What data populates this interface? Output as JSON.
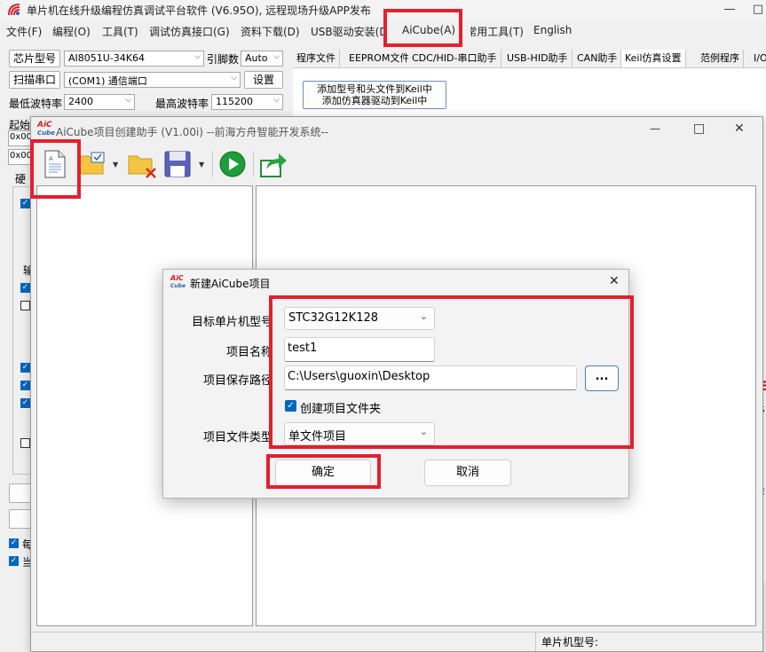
{
  "main_window": {
    "title": "单片机在线升级编程仿真调试平台软件 (V6.95O), 远程现场升级APP发布",
    "controls": {
      "minimize": "—",
      "maximize": "□"
    },
    "menu": [
      "文件(F)",
      "编程(O)",
      "工具(T)",
      "调试仿真接口(G)",
      "资料下载(D)",
      "USB驱动安装(D)",
      "AiCube(A)",
      "常用工具(T)",
      "English"
    ]
  },
  "left_panel": {
    "chip_label": "芯片型号",
    "chip_value": "AI8051U-34K64",
    "pins_label": "引脚数",
    "pins_value": "Auto",
    "scan_button": "扫描串口",
    "port_value": "(COM1) 通信端口",
    "settings_button": "设置",
    "min_baud_label": "最低波特率",
    "min_baud_value": "2400",
    "max_baud_label": "最高波特率",
    "max_baud_value": "115200",
    "start_label": "起始",
    "addr1": "0x00",
    "addr2": "0x00",
    "hw_label": "硬",
    "out_label": "输",
    "bottom_check1": "每",
    "bottom_check2": "当"
  },
  "tabs": [
    "程序文件",
    "EEPROM文件",
    "CDC/HID-串口助手",
    "USB-HID助手",
    "CAN助手",
    "Keil仿真设置",
    "范例程序",
    "I/O"
  ],
  "keil_panel": {
    "add_button_line1": "添加型号和头文件到Keil中",
    "add_button_line2": "添加仿真器驱动到Keil中"
  },
  "right_edge_chars": [
    "E",
    "$",
    ":",
    "!"
  ],
  "assistant": {
    "logo": "AiC",
    "title": "AiCube项目创建助手 (V1.00i) --前海方舟智能开发系统--",
    "controls": {
      "minimize": "—",
      "maximize": "□",
      "close": "✕"
    },
    "toolbar_icons": [
      "new-file-icon",
      "open-folder-icon",
      "delete-folder-icon",
      "save-icon",
      "run-icon",
      "export-icon"
    ],
    "status_label": "单片机型号:"
  },
  "dialog": {
    "logo": "AiC",
    "title": "新建AiCube项目",
    "close": "✕",
    "target_label": "目标单片机型号",
    "target_value": "STC32G12K128",
    "name_label": "项目名称",
    "name_value": "test1",
    "path_label": "项目保存路径",
    "path_value": "C:\\Users\\guoxin\\Desktop",
    "browse_label": "...",
    "create_folder_label": "创建项目文件夹",
    "create_folder_checked": true,
    "type_label": "项目文件类型",
    "type_value": "单文件项目",
    "ok_label": "确定",
    "cancel_label": "取消"
  },
  "colors": {
    "highlight": "#e2202e",
    "accent": "#0067c0",
    "run_green": "#1e9e3a"
  }
}
